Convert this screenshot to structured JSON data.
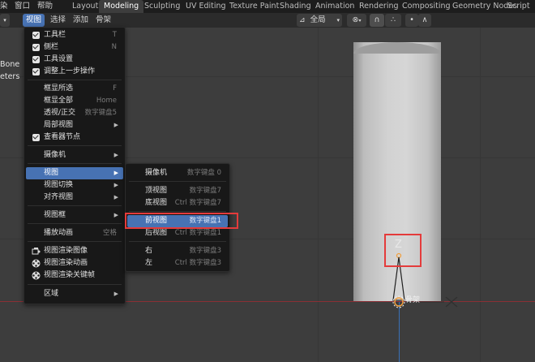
{
  "topbar": {
    "menus": [
      "染",
      "窗口",
      "帮助"
    ],
    "workspace_tabs": [
      "Layout",
      "Modeling",
      "Sculpting",
      "UV Editing",
      "Texture Paint",
      "Shading",
      "Animation",
      "Rendering",
      "Compositing",
      "Geometry Nodes",
      "Script"
    ],
    "active_tab": "Modeling"
  },
  "header": {
    "menus": [
      "视图",
      "选择",
      "添加",
      "骨架"
    ],
    "active_menu": "视图",
    "orientation_label": "全局",
    "snapping_label": "∴"
  },
  "left_panel": {
    "line1": "Bone",
    "line2": "eters"
  },
  "view_menu": {
    "items": [
      {
        "label": "工具栏",
        "shortcut": "T",
        "checked": true
      },
      {
        "label": "侧栏",
        "shortcut": "N",
        "checked": true
      },
      {
        "label": "工具设置",
        "shortcut": "",
        "checked": true
      },
      {
        "label": "调整上一步操作",
        "shortcut": "",
        "checked": true
      },
      {
        "label": "框显所选",
        "shortcut": "F"
      },
      {
        "label": "框显全部",
        "shortcut": "Home"
      },
      {
        "label": "透视/正交",
        "shortcut": "数字键盘5"
      },
      {
        "label": "局部视图",
        "shortcut": ""
      },
      {
        "label": "查看器节点",
        "shortcut": "",
        "checked": true
      },
      {
        "label": "摄像机",
        "shortcut": ""
      },
      {
        "label": "视图",
        "shortcut": ""
      },
      {
        "label": "视图切换",
        "shortcut": ""
      },
      {
        "label": "对齐视图",
        "shortcut": ""
      },
      {
        "label": "视图框",
        "shortcut": ""
      },
      {
        "label": "播放动画",
        "shortcut": "空格"
      },
      {
        "label": "视图渲染图像",
        "shortcut": ""
      },
      {
        "label": "视图渲染动画",
        "shortcut": ""
      },
      {
        "label": "视图渲染关键帧",
        "shortcut": ""
      },
      {
        "label": "区域",
        "shortcut": ""
      }
    ]
  },
  "submenu": {
    "items": [
      {
        "label": "摄像机",
        "shortcut": "数字键盘 0"
      },
      {
        "label": "顶视图",
        "shortcut": "数字键盘7"
      },
      {
        "label": "底视图",
        "shortcut": "Ctrl 数字键盘7"
      },
      {
        "label": "前视图",
        "shortcut": "数字键盘1"
      },
      {
        "label": "后视图",
        "shortcut": "Ctrl 数字键盘1"
      },
      {
        "label": "右",
        "shortcut": "数字键盘3"
      },
      {
        "label": "左",
        "shortcut": "Ctrl 数字键盘3"
      }
    ]
  },
  "viewport": {
    "axis_label": "Z",
    "bone_label": "骨架"
  },
  "colors": {
    "highlight": "#4772b3",
    "annotation": "#e43b3b",
    "x_axis": "#8a2f35",
    "z_axis": "#3a71b6"
  }
}
